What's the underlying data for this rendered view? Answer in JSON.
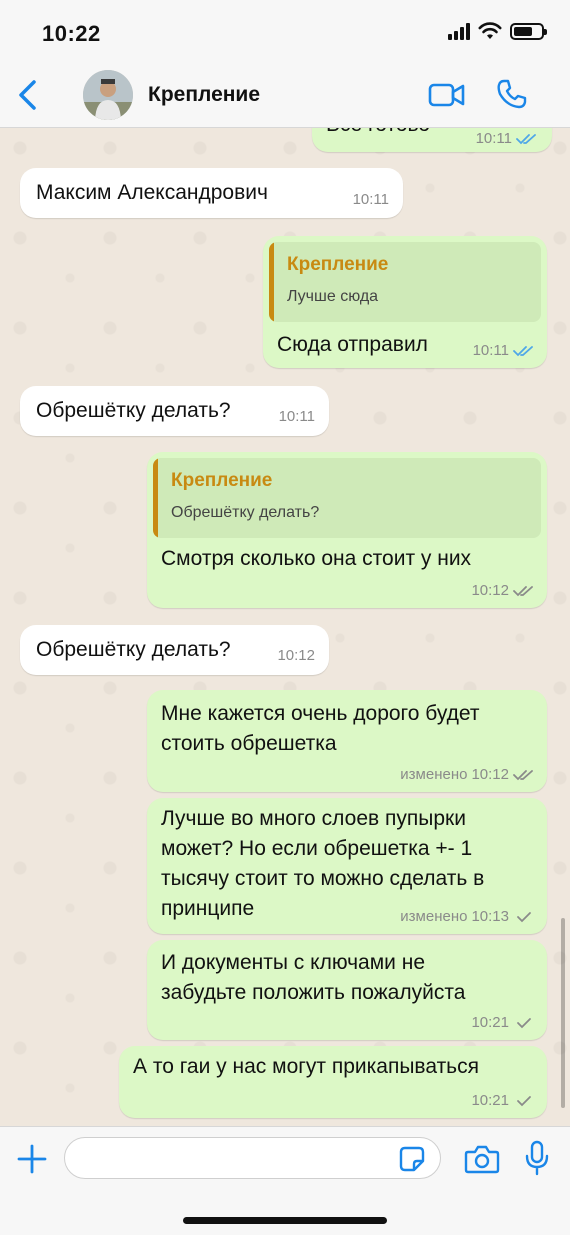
{
  "status_bar": {
    "time": "10:22"
  },
  "header": {
    "contact_name": "Крепление"
  },
  "messages": [
    {
      "dir": "out",
      "text": "Все готово",
      "time": "10:11",
      "ticks": "read"
    },
    {
      "dir": "in",
      "text": "Максим Александрович",
      "time": "10:11"
    },
    {
      "dir": "out",
      "quote_name": "Крепление",
      "quote_text": "Лучше сюда",
      "text": "Сюда отправил",
      "time": "10:11",
      "ticks": "read"
    },
    {
      "dir": "in",
      "text": "Обрешётку делать?",
      "time": "10:11"
    },
    {
      "dir": "out",
      "quote_name": "Крепление",
      "quote_text": "Обрешётку делать?",
      "text": "Смотря сколько она стоит у них",
      "time": "10:12",
      "ticks": "delivered"
    },
    {
      "dir": "in",
      "text": "Обрешётку делать?",
      "time": "10:12"
    },
    {
      "dir": "out",
      "text_lines": [
        "Мне кажется очень дорого будет",
        "стоить обрешетка"
      ],
      "edited": "изменено",
      "time": "10:12",
      "ticks": "delivered"
    },
    {
      "dir": "out",
      "text_lines": [
        "Лучше во много слоев пупырки",
        "может? Но если обрешетка +- 1",
        "тысячу стоит то можно сделать в",
        "принципе"
      ],
      "edited": "изменено",
      "time": "10:13",
      "ticks": "sent"
    },
    {
      "dir": "out",
      "text_lines": [
        "И документы с ключами не",
        "забудьте положить пожалуйста"
      ],
      "time": "10:21",
      "ticks": "sent"
    },
    {
      "dir": "out",
      "text": "А то гаи у нас могут прикапываться",
      "time": "10:21",
      "ticks": "sent"
    }
  ],
  "composer": {
    "placeholder": ""
  },
  "icons": {
    "back": "chevron-left-icon",
    "video": "video-camera-icon",
    "phone": "phone-icon",
    "plus": "plus-icon",
    "sticker": "sticker-icon",
    "camera": "camera-icon",
    "mic": "microphone-icon"
  },
  "colors": {
    "accent": "#1a86e8",
    "outgoing_bubble": "#dcf8c6",
    "incoming_bubble": "#ffffff",
    "quote_name": "#c88a12",
    "read_tick": "#4fa7e8"
  }
}
